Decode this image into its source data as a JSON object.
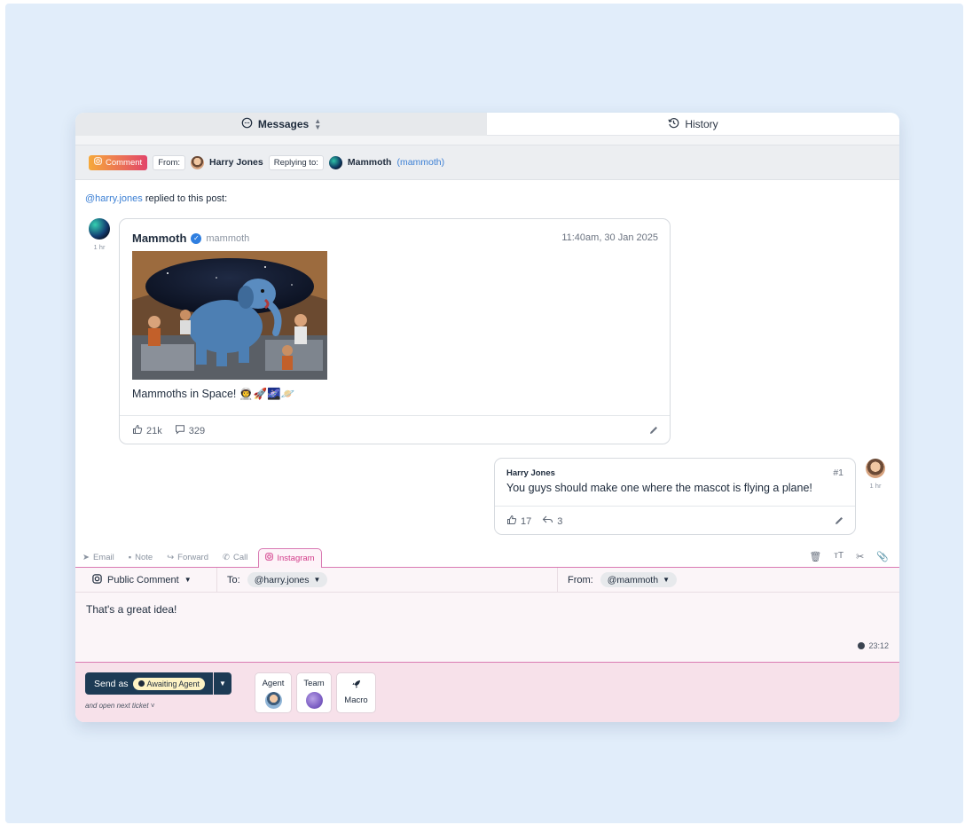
{
  "tabs": {
    "messages": "Messages",
    "history": "History"
  },
  "subheader": {
    "type_label": "Comment",
    "from_label": "From:",
    "from_name": "Harry Jones",
    "replying_label": "Replying to:",
    "replying_name": "Mammoth",
    "replying_handle": "(mammoth)"
  },
  "thread": {
    "mention": "@harry.jones",
    "reply_suffix": " replied to this post:"
  },
  "post": {
    "time_ago": "1 hr",
    "author": "Mammoth",
    "handle": "mammoth",
    "date": "11:40am, 30 Jan 2025",
    "text": "Mammoths in Space! 👨‍🚀🚀🌌🪐",
    "likes": "21k",
    "comments": "329"
  },
  "reply": {
    "author": "Harry Jones",
    "number": "#1",
    "text": "You guys should make one where the mascot is flying a plane!",
    "likes": "17",
    "shares": "3",
    "time_ago": "1 hr"
  },
  "composer": {
    "tabs": [
      "Email",
      "Note",
      "Forward",
      "Call",
      "Instagram"
    ],
    "type": "Public Comment",
    "to_label": "To:",
    "to_handle": "@harry.jones",
    "from_label": "From:",
    "from_handle": "@mammoth",
    "text": "That's a great idea!",
    "timer": "23:12"
  },
  "footer": {
    "send_label": "Send as",
    "status": "Awaiting Agent",
    "next_ticket": "and open next ticket",
    "agent_label": "Agent",
    "team_label": "Team",
    "macro_label": "Macro"
  },
  "colors": {
    "accent_pink": "#d97ab3",
    "send_button": "#1d3b55",
    "link_blue": "#3b7fd4",
    "background": "#e1edfa"
  }
}
